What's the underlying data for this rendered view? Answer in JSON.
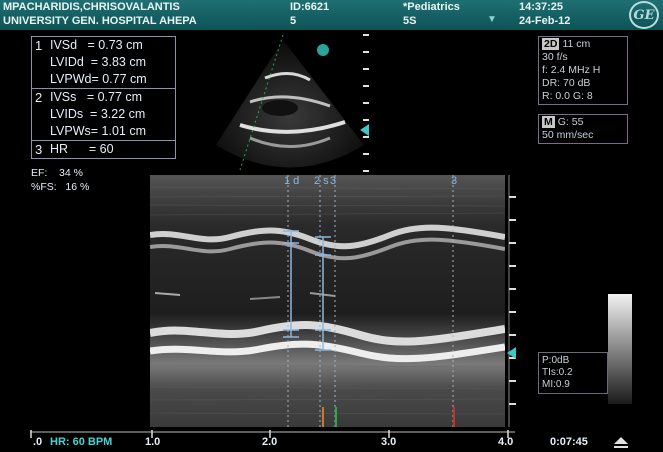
{
  "header": {
    "patient_name": "MPACHARIDIS,CHRISOVALANTIS",
    "institution": "UNIVERSITY  GEN. HOSPITAL AHEPA",
    "id": "ID:6621",
    "id_sub": "5",
    "preset": "*Pediatrics",
    "probe": "5S",
    "time": "14:37:25",
    "date": "24-Feb-12",
    "logo": "GE"
  },
  "measurements": [
    {
      "num": "1",
      "rows": [
        "IVSd   = 0.73 cm",
        "LVIDd  = 3.83 cm",
        "LVPWd= 0.77 cm"
      ]
    },
    {
      "num": "2",
      "rows": [
        "IVSs   = 0.77 cm",
        "LVIDs  = 3.22 cm",
        "LVPWs= 1.01 cm"
      ]
    },
    {
      "num": "3",
      "rows": [
        "HR      = 60"
      ]
    }
  ],
  "ef": {
    "ef": "EF:    34 %",
    "fs": "%FS:   16 %"
  },
  "settings_2d": {
    "tag": "2D",
    "depth": "11 cm",
    "rows": [
      "30 f/s",
      "f: 2.4 MHz H",
      "DR: 70 dB",
      "R: 0.0   G: 8"
    ]
  },
  "settings_m": {
    "tag": "M",
    "gain": "G: 55",
    "speed": "50 mm/sec"
  },
  "power": [
    "P:0dB",
    "TIs:0.2",
    "MI:0.9"
  ],
  "mmode_labels": {
    "c1": "1 d",
    "c2": "2 s",
    "c3": "3",
    "c4": "3"
  },
  "timeline": {
    "left_zero": ".0",
    "hr": "HR: 60 BPM",
    "ticks": [
      "1.0",
      "2.0",
      "3.0",
      "4.0"
    ],
    "elapsed": "0:07:45"
  },
  "colors": {
    "accent": "#3fc6c6",
    "header": "#1a6568",
    "caliper": "#8ab8e0"
  }
}
